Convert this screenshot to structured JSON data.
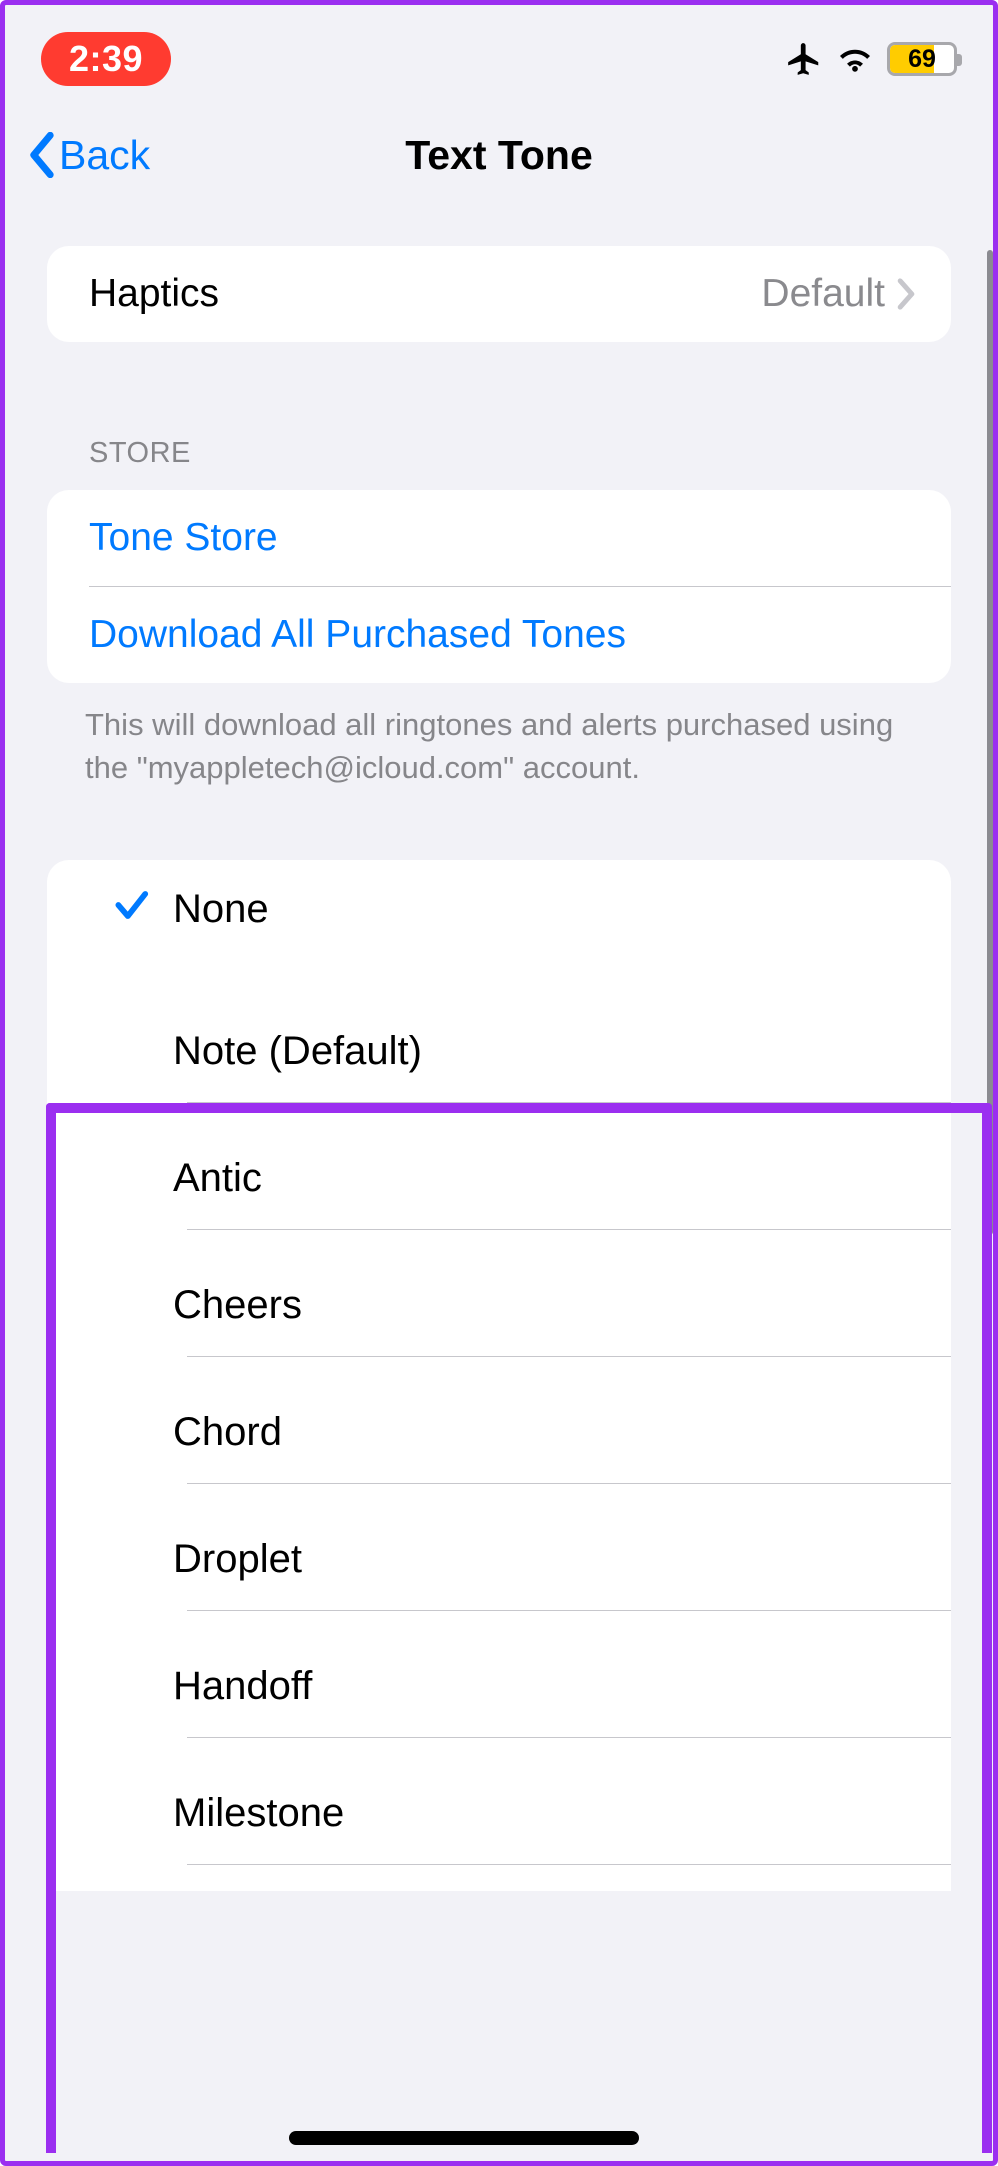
{
  "statusbar": {
    "time": "2:39",
    "battery": "69"
  },
  "nav": {
    "back": "Back",
    "title": "Text Tone"
  },
  "haptics": {
    "label": "Haptics",
    "value": "Default"
  },
  "store": {
    "header": "STORE",
    "tone_store": "Tone Store",
    "download_all": "Download All Purchased Tones",
    "footer": "This will download all ringtones and alerts purchased using the \"myappletech@icloud.com\" account."
  },
  "tones": {
    "selected_index": 0,
    "items": [
      "None",
      "Note (Default)",
      "Antic",
      "Cheers",
      "Chord",
      "Droplet",
      "Handoff",
      "Milestone"
    ]
  }
}
